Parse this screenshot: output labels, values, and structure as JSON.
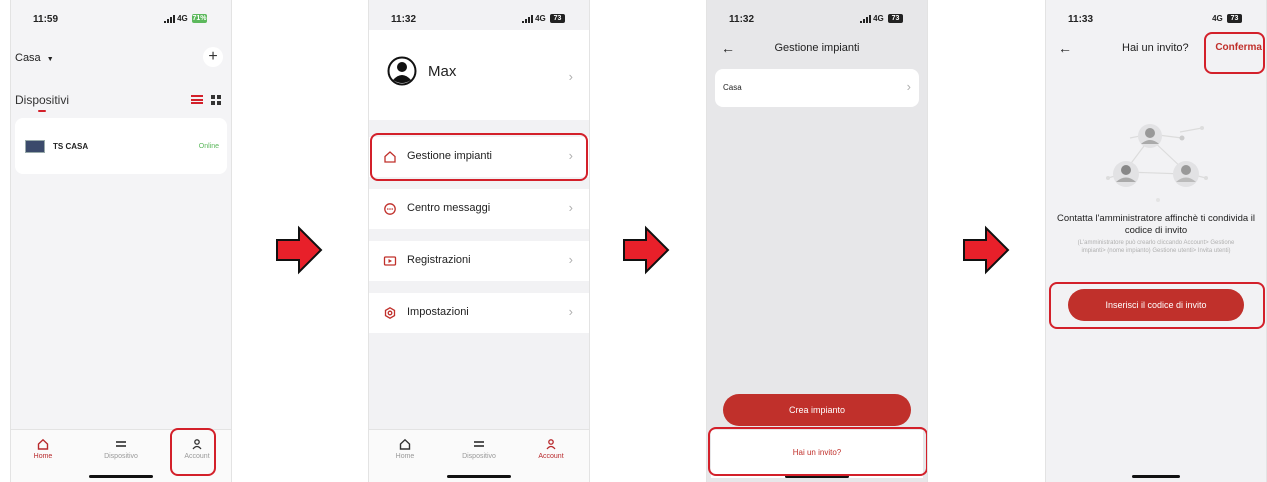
{
  "colors": {
    "accent": "#b8292c",
    "highlight": "#d3202a",
    "online": "#5cb85c",
    "arrow": "#e8202a"
  },
  "screen1": {
    "time": "11:59",
    "network": "4G",
    "battery": "71%",
    "home_selector": "Casa",
    "section_title": "Dispositivi",
    "device": {
      "name": "TS CASA",
      "status": "Online"
    },
    "tabs": [
      "Home",
      "Dispositivo",
      "Account"
    ]
  },
  "screen2": {
    "time": "11:32",
    "network": "4G",
    "battery": "73",
    "user_name": "Max",
    "menu": [
      "Gestione impianti",
      "Centro messaggi",
      "Registrazioni",
      "Impostazioni"
    ],
    "tabs": [
      "Home",
      "Dispositivo",
      "Account"
    ]
  },
  "screen3": {
    "time": "11:32",
    "network": "4G",
    "battery": "73",
    "title": "Gestione impianti",
    "item": "Casa",
    "create_button": "Crea impianto",
    "invite_link": "Hai un invito?"
  },
  "screen4": {
    "time": "11:33",
    "network": "4G",
    "battery": "73",
    "title": "Hai un invito?",
    "confirm": "Conferma",
    "heading": "Contatta l'amministratore affinchè ti condivida il codice di invito",
    "description": "(L'amministratore può crearlo cliccando Account> Gestione impianti> (nome impianto) Gestione utenti> Invita utenti)",
    "button": "Inserisci il codice di invito"
  }
}
